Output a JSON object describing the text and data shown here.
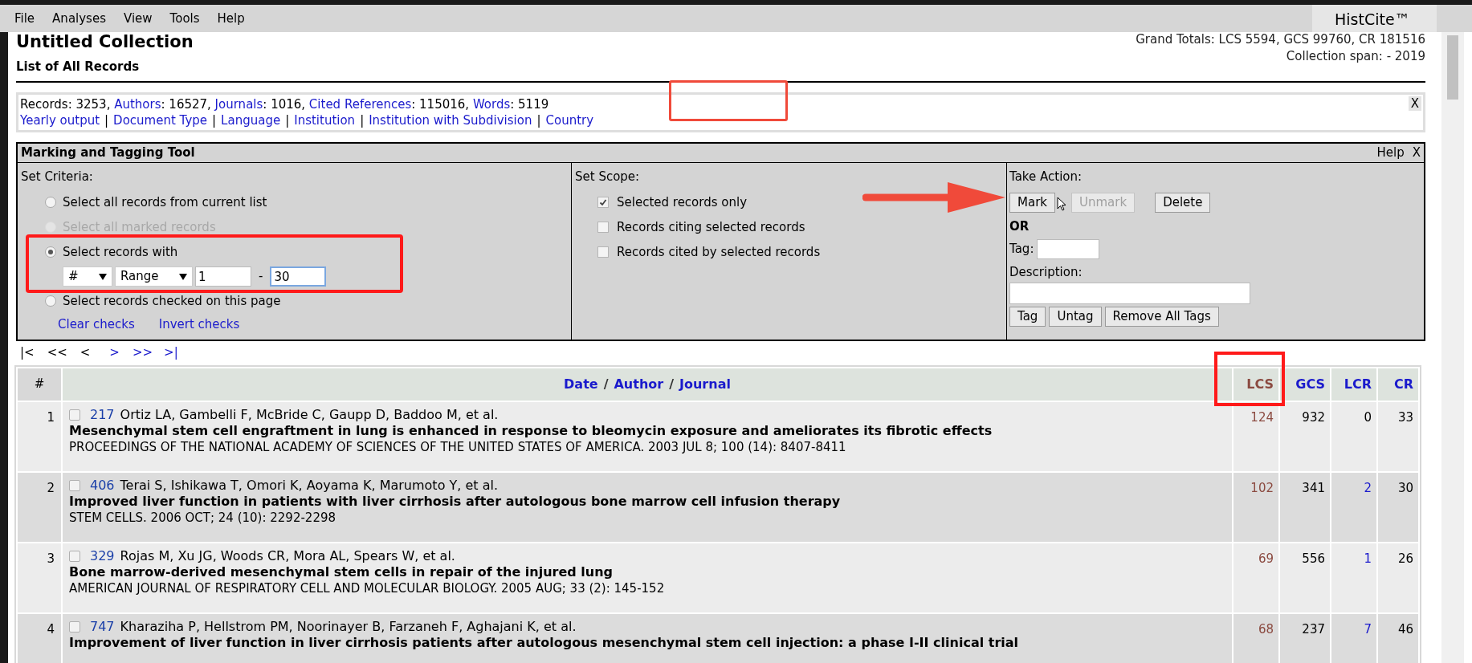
{
  "menu": [
    "File",
    "Analyses",
    "View",
    "Tools",
    "Help"
  ],
  "app_name": "HistCite™",
  "collection": {
    "title": "Untitled Collection",
    "subtitle": "List of All Records",
    "grand_totals": "Grand Totals: LCS 5594, GCS 99760, CR 181516",
    "span": "Collection span: - 2019"
  },
  "summary": {
    "stats": [
      {
        "label": "Records",
        "value": ": 3253",
        "link": false
      },
      {
        "label": "Authors",
        "value": ": 16527",
        "link": true
      },
      {
        "label": "Journals",
        "value": ": 1016",
        "link": true
      },
      {
        "label": "Cited References",
        "value": ": 115016",
        "link": true
      },
      {
        "label": "Words",
        "value": ": 5119",
        "link": true
      }
    ],
    "stat_separator": ",",
    "links": [
      "Yearly output",
      "Document Type",
      "Language",
      "Institution",
      "Institution with Subdivision",
      "Country"
    ],
    "link_separator": "|",
    "close": "X"
  },
  "tool": {
    "title": "Marking and Tagging Tool",
    "help": "Help",
    "close": "X",
    "criteria": {
      "label": "Set Criteria:",
      "options": [
        {
          "label": "Select all records from current list",
          "selected": false,
          "disabled": false
        },
        {
          "label": "Select all marked records",
          "selected": false,
          "disabled": true
        },
        {
          "label": "Select records with",
          "selected": true,
          "disabled": false
        },
        {
          "label": "Select records checked on this page",
          "selected": false,
          "disabled": false
        }
      ],
      "field_select": "#",
      "mode_select": "Range",
      "from": "1",
      "range_separator": "-",
      "to": "30",
      "links": [
        "Clear checks",
        "Invert checks"
      ]
    },
    "scope": {
      "label": "Set Scope:",
      "options": [
        {
          "label": "Selected records only",
          "checked": true
        },
        {
          "label": "Records citing selected records",
          "checked": false
        },
        {
          "label": "Records cited by selected records",
          "checked": false
        }
      ]
    },
    "action": {
      "label": "Take Action:",
      "buttons": [
        {
          "label": "Mark",
          "disabled": false
        },
        {
          "label": "Unmark",
          "disabled": true
        },
        {
          "label": "Delete",
          "disabled": false
        }
      ],
      "or": "OR",
      "tag_label": "Tag:",
      "description_label": "Description:",
      "tag_buttons": [
        "Tag",
        "Untag",
        "Remove All Tags"
      ]
    }
  },
  "pager": [
    {
      "label": "|<",
      "disabled": true
    },
    {
      "label": "<<",
      "disabled": true
    },
    {
      "label": "<",
      "disabled": true
    },
    {
      "label": ">",
      "disabled": false
    },
    {
      "label": ">>",
      "disabled": false
    },
    {
      "label": ">|",
      "disabled": false
    }
  ],
  "table": {
    "number_header": "#",
    "main_header": [
      "Date",
      "Author",
      "Journal"
    ],
    "main_separator": "/",
    "metric_headers": [
      {
        "label": "LCS",
        "sorted": true
      },
      {
        "label": "GCS",
        "sorted": false
      },
      {
        "label": "LCR",
        "sorted": false
      },
      {
        "label": "CR",
        "sorted": false
      }
    ],
    "rows": [
      {
        "num": "1",
        "checked": false,
        "id": "217",
        "authors": "Ortiz LA, Gambelli F, McBride C, Gaupp D, Baddoo M, et al.",
        "title": "Mesenchymal stem cell engraftment in lung is enhanced in response to bleomycin exposure and ameliorates its fibrotic effects",
        "source": "PROCEEDINGS OF THE NATIONAL ACADEMY OF SCIENCES OF THE UNITED STATES OF AMERICA. 2003 JUL 8; 100 (14): 8407-8411",
        "lcs": "124",
        "gcs": "932",
        "lcr": "0",
        "lcr_linked": false,
        "cr": "33"
      },
      {
        "num": "2",
        "checked": false,
        "id": "406",
        "authors": "Terai S, Ishikawa T, Omori K, Aoyama K, Marumoto Y, et al.",
        "title": "Improved liver function in patients with liver cirrhosis after autologous bone marrow cell infusion therapy",
        "source": "STEM CELLS. 2006 OCT; 24 (10): 2292-2298",
        "lcs": "102",
        "gcs": "341",
        "lcr": "2",
        "lcr_linked": true,
        "cr": "30"
      },
      {
        "num": "3",
        "checked": false,
        "id": "329",
        "authors": "Rojas M, Xu JG, Woods CR, Mora AL, Spears W, et al.",
        "title": "Bone marrow-derived mesenchymal stem cells in repair of the injured lung",
        "source": "AMERICAN JOURNAL OF RESPIRATORY CELL AND MOLECULAR BIOLOGY. 2005 AUG; 33 (2): 145-152",
        "lcs": "69",
        "gcs": "556",
        "lcr": "1",
        "lcr_linked": true,
        "cr": "26"
      },
      {
        "num": "4",
        "checked": false,
        "id": "747",
        "authors": "Kharaziha P, Hellstrom PM, Noorinayer B, Farzaneh F, Aghajani K, et al.",
        "title": "Improvement of liver function in liver cirrhosis patients after autologous mesenchymal stem cell injection: a phase I-II clinical trial",
        "lcs": "68",
        "gcs": "237",
        "lcr": "7",
        "lcr_linked": true,
        "cr": "46"
      }
    ]
  }
}
